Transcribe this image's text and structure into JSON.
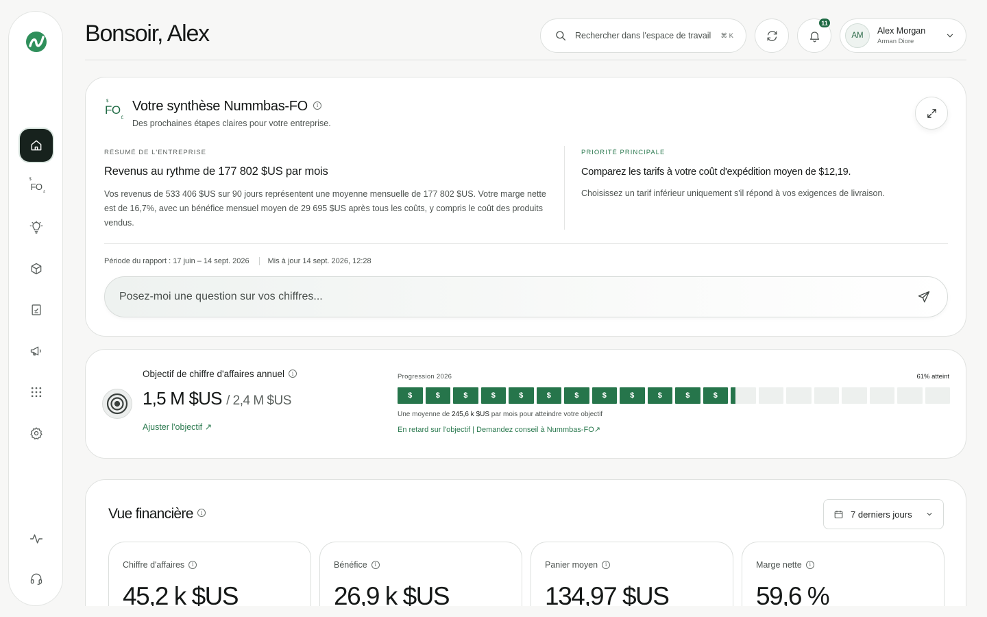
{
  "header": {
    "greeting": "Bonsoir, Alex",
    "search_placeholder": "Rechercher dans l'espace de travail",
    "search_shortcut": "⌘ K",
    "notifications_count": "11",
    "user": {
      "initials": "AM",
      "name": "Alex Morgan",
      "subtitle": "Arman Diore"
    }
  },
  "sidebar": {
    "items": [
      {
        "name": "home",
        "icon": "home-icon",
        "active": true
      },
      {
        "name": "fo",
        "label_main": "FO",
        "label_top": "$",
        "label_sub": "£"
      },
      {
        "name": "insights",
        "icon": "lightbulb-icon"
      },
      {
        "name": "products",
        "icon": "box-icon"
      },
      {
        "name": "reports",
        "icon": "clipboard-check-icon"
      },
      {
        "name": "marketing",
        "icon": "megaphone-icon"
      },
      {
        "name": "apps",
        "icon": "grid-dots-icon"
      },
      {
        "name": "settings",
        "icon": "gear-icon"
      },
      {
        "name": "activity",
        "icon": "pulse-icon"
      },
      {
        "name": "support",
        "icon": "headset-icon"
      }
    ]
  },
  "summary": {
    "logo_text": "FO",
    "logo_top": "$",
    "logo_sub": "£",
    "title": "Votre synthèse Nummbas-FO",
    "subtitle": "Des prochaines étapes claires pour votre entreprise.",
    "left": {
      "label": "Résumé de l'entreprise",
      "title": "Revenus au rythme de 177 802 $US par mois",
      "body": "Vos revenus de 533 406 $US sur 90 jours représentent une moyenne mensuelle de 177 802 $US. Votre marge nette est de 16,7%, avec un bénéfice mensuel moyen de 29 695 $US après tous les coûts, y compris le coût des produits vendus."
    },
    "right": {
      "label": "Priorité principale",
      "title": "Comparez les tarifs à votre coût d'expédition moyen de $12,19.",
      "body": "Choisissez un tarif inférieur uniquement s'il répond à vos exigences de livraison."
    },
    "period": "Période du rapport : 17 juin – 14 sept. 2026",
    "updated": "Mis à jour 14 sept. 2026, 12:28",
    "ask_placeholder": "Posez-moi une question sur vos chiffres..."
  },
  "goal": {
    "title": "Objectif de chiffre d'affaires annuel",
    "current": "1,5 M $US",
    "target": "/ 2,4 M $US",
    "adjust_label": "Ajuster l'objectif ↗",
    "progress_label": "Progression 2026",
    "progress_reached": "61% atteint",
    "progress_fraction": 0.61,
    "segments_total": 20,
    "segment_symbol": "$",
    "note_prefix": "Une moyenne de ",
    "note_value": "245,6 k $US",
    "note_suffix": " par mois pour atteindre votre objectif",
    "link": "En retard sur l'objectif | Demandez conseil à Nummbas-FO↗"
  },
  "financial": {
    "title": "Vue financière",
    "range": "7 derniers jours",
    "kpis": [
      {
        "label": "Chiffre d'affaires",
        "value": "45,2 k $US"
      },
      {
        "label": "Bénéfice",
        "value": "26,9 k $US"
      },
      {
        "label": "Panier moyen",
        "value": "134,97 $US"
      },
      {
        "label": "Marge nette",
        "value": "59,6 %"
      }
    ]
  },
  "colors": {
    "accent": "#26754b",
    "accent_text": "#2c7a50",
    "active_nav": "#17221d"
  }
}
